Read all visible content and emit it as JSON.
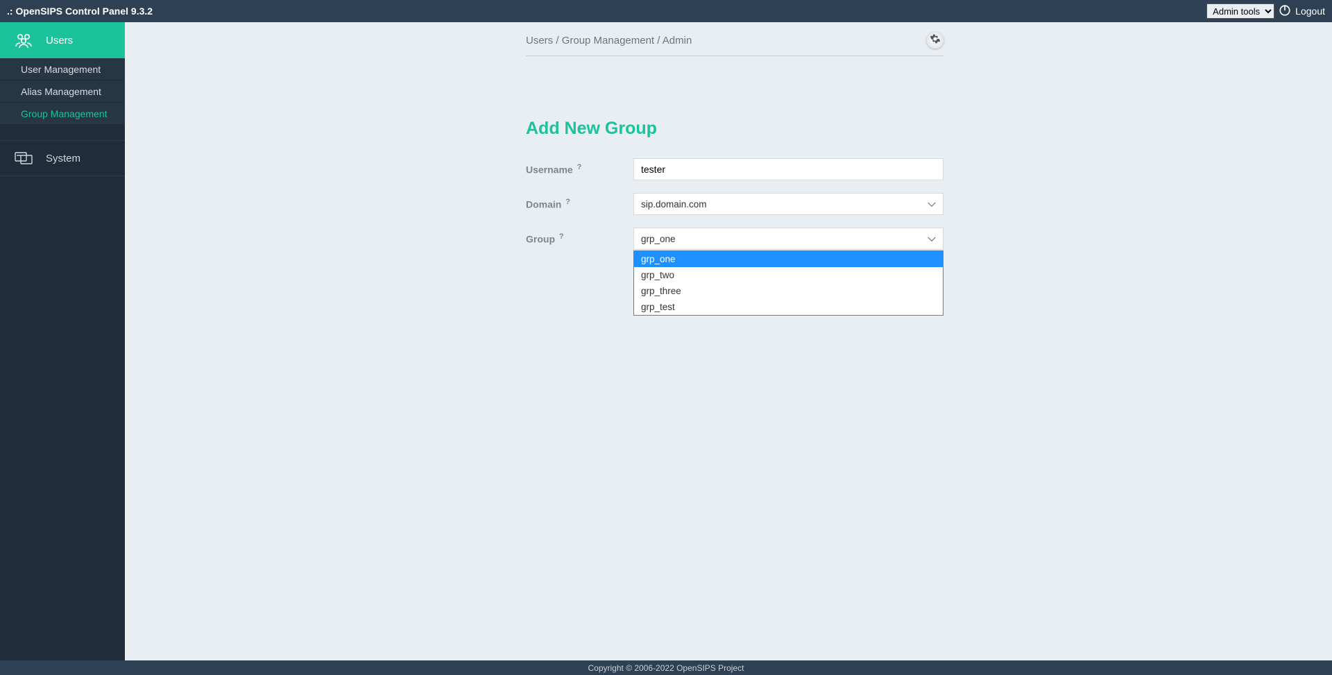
{
  "topbar": {
    "title": ".: OpenSIPS Control Panel 9.3.2",
    "admin_tools_label": "Admin tools",
    "logout_label": "Logout"
  },
  "sidebar": {
    "users": {
      "label": "Users"
    },
    "subitems": [
      {
        "label": "User Management",
        "active": false
      },
      {
        "label": "Alias Management",
        "active": false
      },
      {
        "label": "Group Management",
        "active": true
      }
    ],
    "system": {
      "label": "System"
    }
  },
  "breadcrumb": {
    "part1": "Users",
    "sep1": " / ",
    "part2": "Group Management",
    "sep2": " / ",
    "part3": "Admin"
  },
  "form": {
    "title": "Add New Group",
    "username_label": "Username",
    "username_value": "tester",
    "domain_label": "Domain",
    "domain_selected": "sip.domain.com",
    "group_label": "Group",
    "group_selected": "grp_one",
    "group_options": [
      "grp_one",
      "grp_two",
      "grp_three",
      "grp_test"
    ],
    "help_symbol": "?"
  },
  "footer": {
    "text": "Copyright © 2006-2022 OpenSIPS Project"
  }
}
